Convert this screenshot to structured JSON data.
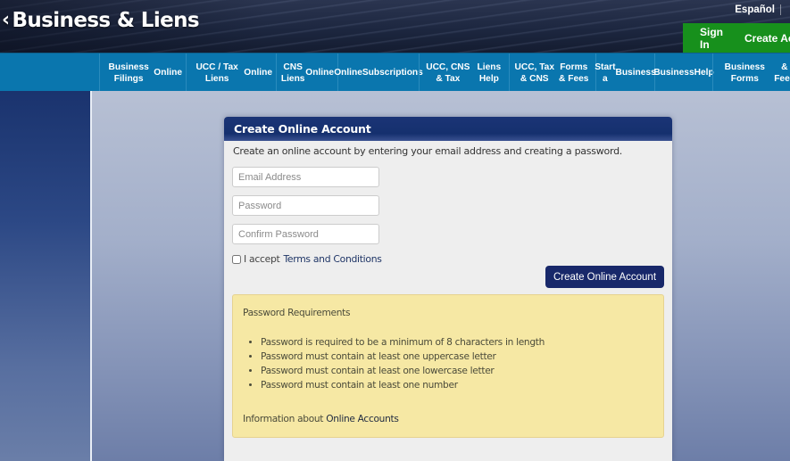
{
  "header": {
    "brand": "Business & Liens",
    "back_icon": "chevron-left-icon",
    "language_link": "Español",
    "sign_in": "Sign In",
    "create_account_short": "Create Account"
  },
  "nav": {
    "items": [
      {
        "line1": "Business Filings",
        "line2": "Online"
      },
      {
        "line1": "UCC / Tax Liens",
        "line2": "Online"
      },
      {
        "line1": "CNS Liens",
        "line2": "Online"
      },
      {
        "line1": "Online",
        "line2": "Subscriptions"
      },
      {
        "line1": "UCC, CNS & Tax",
        "line2": "Liens Help"
      },
      {
        "line1": "UCC, Tax & CNS",
        "line2": "Forms & Fees"
      },
      {
        "line1": "Start a",
        "line2": "Business"
      },
      {
        "line1": "Business",
        "line2": "Help"
      },
      {
        "line1": "Business Forms",
        "line2": "& Fees"
      }
    ]
  },
  "panel": {
    "title": "Create Online Account",
    "intro": "Create an online account by entering your email address and creating a password.",
    "fields": {
      "email_placeholder": "Email Address",
      "email_value": "",
      "password_placeholder": "Password",
      "password_value": "",
      "confirm_placeholder": "Confirm Password",
      "confirm_value": ""
    },
    "terms": {
      "checked": false,
      "prefix": "I accept",
      "link": "Terms and Conditions"
    },
    "submit_label": "Create Online Account",
    "requirements": {
      "title": "Password Requirements",
      "items": [
        "Password is required to be a minimum of 8 characters in length",
        "Password must contain at least one uppercase letter",
        "Password must contain at least one lowercase letter",
        "Password must contain at least one number"
      ],
      "info_prefix": "Information about",
      "info_link": "Online Accounts"
    }
  },
  "colors": {
    "nav_blue": "#0a76ae",
    "account_green": "#17901c",
    "panel_header_navy": "#15306e",
    "button_navy": "#18286a",
    "requirements_yellow": "#f6e8a4"
  }
}
